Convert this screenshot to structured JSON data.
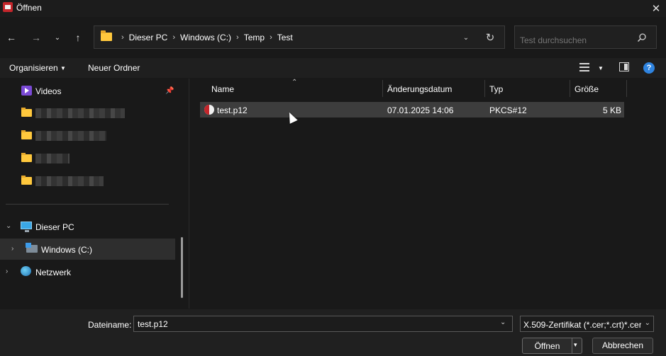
{
  "window": {
    "title": "Öffnen",
    "close_glyph": "✕"
  },
  "nav": {
    "back_glyph": "←",
    "forward_glyph": "→",
    "recent_glyph": "⌄",
    "up_glyph": "↑"
  },
  "address": {
    "crumbs": [
      "Dieser PC",
      "Windows (C:)",
      "Temp",
      "Test"
    ],
    "separator": "›",
    "dropdown_glyph": "⌄",
    "refresh_glyph": "↻"
  },
  "search": {
    "placeholder": "Test durchsuchen",
    "icon": "search-icon"
  },
  "toolbar": {
    "organize_label": "Organisieren",
    "organize_arrow": "▼",
    "new_folder_label": "Neuer Ordner",
    "view_arrow": "▼",
    "help_glyph": "?"
  },
  "sidebar": {
    "pin_glyph": "📌",
    "quick_items": [
      {
        "label": "Videos",
        "icon": "video-icon"
      }
    ],
    "redacted_folder_count": 4,
    "tree": [
      {
        "label": "Dieser PC",
        "chevron": "⌄",
        "icon": "pc-icon"
      },
      {
        "label": "Windows (C:)",
        "chevron": "›",
        "icon": "drive-icon",
        "selected": true
      },
      {
        "label": "Netzwerk",
        "chevron": "›",
        "icon": "network-icon"
      }
    ]
  },
  "columns": {
    "name": "Name",
    "date": "Änderungsdatum",
    "type": "Typ",
    "size": "Größe",
    "sort_glyph": "⌃"
  },
  "files": [
    {
      "name": "test.p12",
      "date": "07.01.2025 14:06",
      "type": "PKCS#12",
      "size": "5 KB",
      "icon": "certificate-icon"
    }
  ],
  "footer": {
    "filename_label": "Dateiname:",
    "filename_value": "test.p12",
    "filename_dropdown": "⌄",
    "filetype_value": "X.509-Zertifikat (*.cer;*.crt)*.cer",
    "filetype_arrow": "⌄",
    "open_label": "Öffnen",
    "open_arrow": "▾",
    "cancel_label": "Abbrechen"
  },
  "colors": {
    "accent": "#2f84e0",
    "folder": "#ffc83d",
    "row_selected": "#3d3d3d"
  }
}
